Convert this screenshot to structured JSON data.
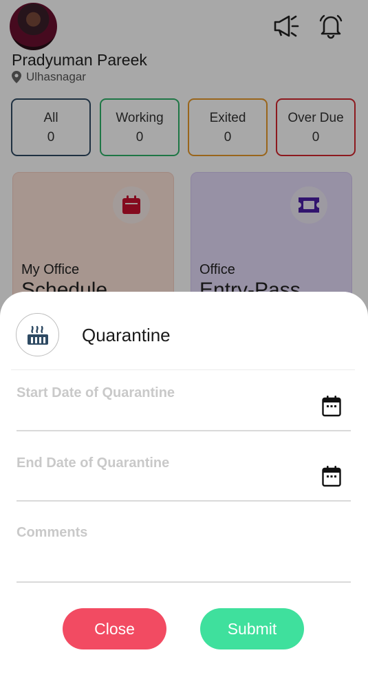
{
  "user": {
    "name": "Pradyuman Pareek",
    "location": "Ulhasnagar"
  },
  "header_icons": [
    "megaphone-icon",
    "bell-icon"
  ],
  "stats": [
    {
      "label": "All",
      "value": "0",
      "color": "#2e4a63"
    },
    {
      "label": "Working",
      "value": "0",
      "color": "#2eb36a"
    },
    {
      "label": "Exited",
      "value": "0",
      "color": "#e89a2a"
    },
    {
      "label": "Over Due",
      "value": "0",
      "color": "#d7262e"
    }
  ],
  "cards": [
    {
      "subtitle": "My Office",
      "title": "Schedule",
      "icon": "calendar-icon",
      "icon_color": "#c8102e"
    },
    {
      "subtitle": "Office",
      "title": "Entry-Pass",
      "icon": "ticket-icon",
      "icon_color": "#4b1fa8"
    }
  ],
  "sheet": {
    "icon": "quarantine-icon",
    "title": "Quarantine",
    "start_label": "Start Date of Quarantine",
    "end_label": "End Date of Quarantine",
    "comments_label": "Comments",
    "close_label": "Close",
    "submit_label": "Submit",
    "close_color": "#f24b62",
    "submit_color": "#3fe09d"
  }
}
